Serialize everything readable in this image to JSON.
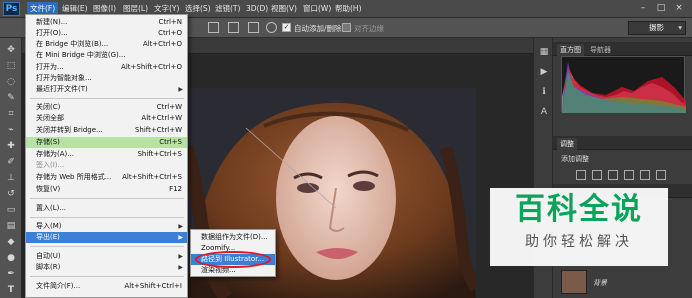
{
  "app": {
    "logo": "Ps"
  },
  "menubar": {
    "items": [
      {
        "label": "文件(F)",
        "active": true
      },
      {
        "label": "编辑(E)"
      },
      {
        "label": "图像(I)"
      },
      {
        "label": "图层(L)"
      },
      {
        "label": "文字(Y)"
      },
      {
        "label": "选择(S)"
      },
      {
        "label": "滤镜(T)"
      },
      {
        "label": "3D(D)"
      },
      {
        "label": "视图(V)"
      },
      {
        "label": "窗口(W)"
      },
      {
        "label": "帮助(H)"
      }
    ],
    "window_buttons": [
      "–",
      "□",
      "×"
    ]
  },
  "optionsbar": {
    "auto_add_delete": "自动添加/删除",
    "align_edges": "对齐边缘",
    "workspace": "摄影"
  },
  "file_menu": {
    "items": [
      {
        "label": "新建(N)...",
        "shortcut": "Ctrl+N"
      },
      {
        "label": "打开(O)...",
        "shortcut": "Ctrl+O"
      },
      {
        "label": "在 Bridge 中浏览(B)...",
        "shortcut": "Alt+Ctrl+O"
      },
      {
        "label": "在 Mini Bridge 中浏览(G)...",
        "shortcut": ""
      },
      {
        "label": "打开为...",
        "shortcut": "Alt+Shift+Ctrl+O"
      },
      {
        "label": "打开为智能对象...",
        "shortcut": ""
      },
      {
        "label": "最近打开文件(T)",
        "shortcut": "",
        "submenu": true
      },
      {
        "label": "关闭(C)",
        "shortcut": "Ctrl+W"
      },
      {
        "label": "关闭全部",
        "shortcut": "Alt+Ctrl+W"
      },
      {
        "label": "关闭并转到 Bridge...",
        "shortcut": "Shift+Ctrl+W"
      },
      {
        "label": "存储(S)",
        "shortcut": "Ctrl+S",
        "highlight": "green"
      },
      {
        "label": "存储为(A)...",
        "shortcut": "Shift+Ctrl+S"
      },
      {
        "label": "签入(I)...",
        "shortcut": ""
      },
      {
        "label": "存储为 Web 所用格式...",
        "shortcut": "Alt+Shift+Ctrl+S"
      },
      {
        "label": "恢复(V)",
        "shortcut": "F12"
      },
      {
        "label": "置入(L)...",
        "shortcut": ""
      },
      {
        "label": "导入(M)",
        "shortcut": "",
        "submenu": true
      },
      {
        "label": "导出(E)",
        "shortcut": "",
        "submenu": true,
        "highlight": "blue"
      },
      {
        "label": "自动(U)",
        "shortcut": "",
        "submenu": true
      },
      {
        "label": "脚本(R)",
        "shortcut": "",
        "submenu": true
      },
      {
        "label": "文件简介(F)...",
        "shortcut": "Alt+Shift+Ctrl+I"
      }
    ]
  },
  "export_submenu": {
    "items": [
      {
        "label": "数据组作为文件(D)..."
      },
      {
        "label": "Zoomify..."
      },
      {
        "label": "路径到 Illustrator...",
        "highlight": true
      },
      {
        "label": "渲染视频..."
      }
    ]
  },
  "panels": {
    "histogram_tabs": [
      "直方图",
      "导航器"
    ],
    "adjustments_tab": "调整",
    "adjustments_title": "添加调整",
    "layer_name": "背景"
  },
  "watermark": {
    "title": "百科全说",
    "subtitle": "助你轻松解决"
  },
  "colors": {
    "menu_highlight": "#3d7ed6",
    "save_highlight": "#b7e2a4",
    "watermark_green": "#0aa35a",
    "annotation_red": "#e01b1b"
  }
}
